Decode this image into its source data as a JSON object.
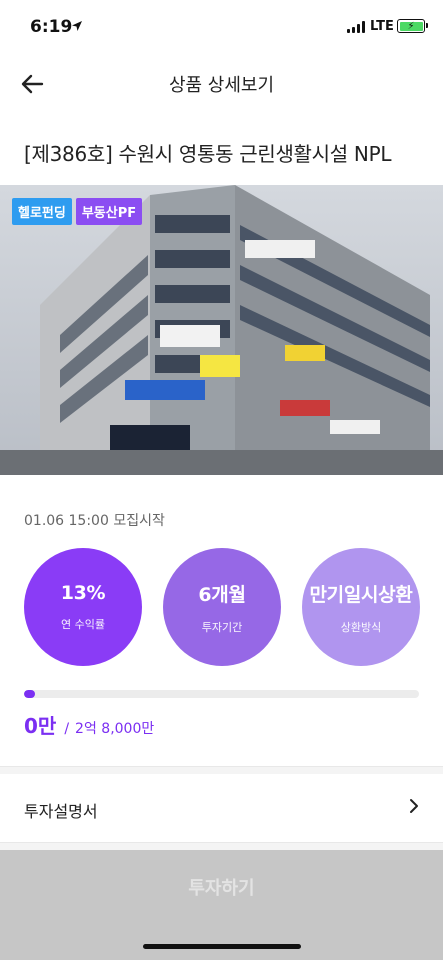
{
  "status_bar": {
    "time": "6:19",
    "network": "LTE",
    "battery_color": "#4cd964"
  },
  "nav": {
    "title": "상품 상세보기",
    "back_icon": "arrow-left-icon"
  },
  "product": {
    "title": "[제386호] 수원시 영통동 근린생활시설 NPL",
    "tags": [
      "헬로펀딩",
      "부동산PF"
    ],
    "tag_colors": [
      "#2e9cf0",
      "#8b4df2"
    ],
    "image_alt": "building-photo"
  },
  "funding": {
    "start_text": "01.06 15:00 모집시작",
    "stats": [
      {
        "value": "13%",
        "label": "연 수익률"
      },
      {
        "value": "6개월",
        "label": "투자기간"
      },
      {
        "value": "만기일시상환",
        "label": "상환방식"
      }
    ],
    "progress_fraction": 0.028,
    "current": "0만",
    "separator": "/",
    "goal": "2억 8,000만"
  },
  "menu": {
    "prospectus_label": "투자설명서"
  },
  "cta": {
    "label": "투자하기"
  },
  "colors": {
    "accent": "#7b2ff2",
    "cta_disabled": "#c6c6c6"
  }
}
